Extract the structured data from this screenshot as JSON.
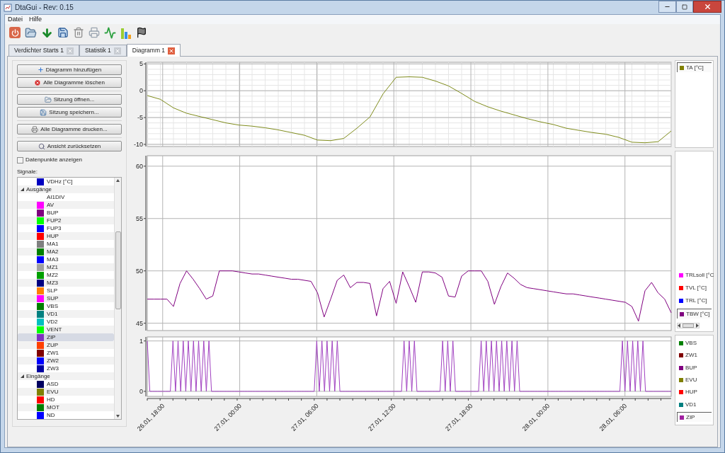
{
  "window": {
    "title": "DtaGui - Rev: 0.15"
  },
  "menu": [
    "Datei",
    "Hilfe"
  ],
  "tabs": [
    {
      "label": "Verdichter Starts 1",
      "selected": false
    },
    {
      "label": "Statistik 1",
      "selected": false
    },
    {
      "label": "Diagramm 1",
      "selected": true
    }
  ],
  "side_panel": {
    "button_groups": [
      [
        "Diagramm hinzufügen",
        "Alle Diagramme löschen"
      ],
      [
        "Sitzung öffnen...",
        "Sitzung speichern..."
      ],
      [
        "Alle Diagramme drucken..."
      ],
      [
        "Ansicht zurücksetzen"
      ]
    ],
    "show_datapoints": {
      "label": "Datenpunkte anzeigen",
      "checked": false
    },
    "signals_label": "Signale:",
    "signal_tree": [
      {
        "label": "VDHz [°C]",
        "color": "#0000c0",
        "selected": false
      },
      {
        "label": "Ausgänge",
        "expanded": true,
        "children": [
          {
            "label": "AI1DIV",
            "selected": false
          },
          {
            "label": "AV",
            "color": "#ff00ff",
            "selected": false
          },
          {
            "label": "BUP",
            "color": "#800080",
            "selected": false
          },
          {
            "label": "FUP2",
            "color": "#00ff00",
            "selected": false
          },
          {
            "label": "FUP3",
            "color": "#0000ff",
            "selected": false
          },
          {
            "label": "HUP",
            "color": "#ff0000",
            "selected": false
          },
          {
            "label": "MA1",
            "color": "#808080",
            "selected": false
          },
          {
            "label": "MA2",
            "color": "#008000",
            "selected": false
          },
          {
            "label": "MA3",
            "color": "#0000ff",
            "selected": false
          },
          {
            "label": "MZ1",
            "color": "#a0a0a0",
            "selected": false
          },
          {
            "label": "MZ2",
            "color": "#00a000",
            "selected": false
          },
          {
            "label": "MZ3",
            "color": "#000080",
            "selected": false
          },
          {
            "label": "SLP",
            "color": "#ff8000",
            "selected": false
          },
          {
            "label": "SUP",
            "color": "#ff00ff",
            "selected": false
          },
          {
            "label": "VBS",
            "color": "#008000",
            "selected": false
          },
          {
            "label": "VD1",
            "color": "#008080",
            "selected": false
          },
          {
            "label": "VD2",
            "color": "#00c0c0",
            "selected": false
          },
          {
            "label": "VENT",
            "color": "#00ff00",
            "selected": false
          },
          {
            "label": "ZIP",
            "color": "#8030c0",
            "selected": true
          },
          {
            "label": "ZUP",
            "color": "#ff4000",
            "selected": false
          },
          {
            "label": "ZW1",
            "color": "#800000",
            "selected": false
          },
          {
            "label": "ZW2",
            "color": "#0000ff",
            "selected": false
          },
          {
            "label": "ZW3",
            "color": "#0000a0",
            "selected": false
          }
        ]
      },
      {
        "label": "Eingänge",
        "expanded": true,
        "children": [
          {
            "label": "ASD",
            "color": "#000060",
            "selected": false
          },
          {
            "label": "EVU",
            "color": "#808000",
            "selected": false
          },
          {
            "label": "HD",
            "color": "#ff0000",
            "selected": false
          },
          {
            "label": "MOT",
            "color": "#008000",
            "selected": false
          },
          {
            "label": "ND",
            "color": "#0000ff",
            "selected": false
          }
        ]
      }
    ]
  },
  "charts": [
    {
      "legend": [
        {
          "label": "TA [°C]",
          "color": "#808000",
          "selected": true
        }
      ],
      "chart_data": {
        "type": "line",
        "grid": true,
        "categories": [
          null,
          null,
          null,
          null,
          null,
          null,
          null,
          null,
          null,
          null,
          null,
          null,
          null,
          null,
          null,
          null,
          null,
          null,
          null,
          null,
          null,
          null,
          null,
          null,
          null,
          null,
          null,
          null,
          null,
          null,
          null,
          null,
          null,
          null,
          null,
          null,
          null,
          null,
          null,
          null,
          null
        ],
        "series": [
          {
            "color": "#7f8c1c",
            "values": [
              -0.9,
              -1.6,
              -3.2,
              -4.2,
              -4.8,
              -5.4,
              -6.0,
              -6.4,
              -6.6,
              -6.9,
              -7.3,
              -7.8,
              -8.3,
              -9.2,
              -9.3,
              -8.9,
              -7.0,
              -4.9,
              -0.6,
              2.5,
              2.6,
              2.5,
              1.8,
              0.9,
              -0.5,
              -2.0,
              -3.0,
              -3.8,
              -4.5,
              -5.2,
              -5.8,
              -6.3,
              -7.0,
              -7.4,
              -7.8,
              -8.1,
              -8.7,
              -9.6,
              -9.7,
              -9.5,
              -7.5
            ]
          }
        ],
        "ylim": [
          -10.4,
          5.3
        ],
        "yticks": [
          -10,
          -5,
          0,
          5
        ]
      }
    },
    {
      "legend": [
        {
          "label": "TRLsoll [°C",
          "color": "#ff00ff",
          "selected": false
        },
        {
          "label": "TVL [°C]",
          "color": "#ff0000",
          "selected": false
        },
        {
          "label": "TRL [°C]",
          "color": "#0000ff",
          "selected": false
        },
        {
          "label": "TBW [°C]",
          "color": "#800080",
          "selected": true
        }
      ],
      "chart_data": {
        "type": "line",
        "grid": true,
        "categories": [
          null,
          null,
          null,
          null,
          null,
          null,
          null,
          null,
          null,
          null,
          null,
          null,
          null,
          null,
          null,
          null,
          null,
          null,
          null,
          null,
          null,
          null,
          null,
          null,
          null,
          null,
          null,
          null,
          null,
          null,
          null,
          null,
          null,
          null,
          null,
          null,
          null,
          null,
          null,
          null,
          null,
          null,
          null,
          null,
          null,
          null,
          null,
          null,
          null,
          null,
          null,
          null,
          null,
          null,
          null,
          null,
          null,
          null,
          null,
          null,
          null,
          null,
          null,
          null,
          null,
          null,
          null,
          null,
          null,
          null,
          null,
          null,
          null,
          null,
          null,
          null,
          null,
          null,
          null,
          null,
          null
        ],
        "series": [
          {
            "color": "#800080",
            "values": [
              47.3,
              47.3,
              47.3,
              47.3,
              46.6,
              48.8,
              50,
              49.2,
              48.3,
              47.3,
              47.6,
              50,
              50,
              50,
              49.9,
              49.8,
              49.7,
              49.7,
              49.6,
              49.5,
              49.4,
              49.3,
              49.2,
              49.2,
              49.1,
              49.0,
              47.9,
              45.6,
              47.3,
              49.1,
              49.6,
              48.4,
              48.9,
              48.9,
              48.8,
              45.7,
              48.3,
              49,
              46.9,
              49.9,
              48.5,
              47.0,
              49.9,
              49.9,
              49.8,
              49.4,
              47.6,
              47.5,
              49.5,
              50,
              50,
              50,
              49,
              46.8,
              48.5,
              49.8,
              49.3,
              48.7,
              48.4,
              48.3,
              48.2,
              48.1,
              48.0,
              47.9,
              47.8,
              47.8,
              47.7,
              47.6,
              47.5,
              47.4,
              47.3,
              47.2,
              47.1,
              47.0,
              46.6,
              45.2,
              48.1,
              48.9,
              47.9,
              47.3,
              46
            ]
          }
        ],
        "ylim": [
          44.3,
          61
        ],
        "yticks": [
          45,
          50,
          55,
          60
        ]
      }
    },
    {
      "legend": [
        {
          "label": "VBS",
          "color": "#008000",
          "selected": false
        },
        {
          "label": "ZW1",
          "color": "#800000",
          "selected": false
        },
        {
          "label": "BUP",
          "color": "#800080",
          "selected": false
        },
        {
          "label": "EVU",
          "color": "#808000",
          "selected": false
        },
        {
          "label": "HUP",
          "color": "#ff0000",
          "selected": false
        },
        {
          "label": "VD1",
          "color": "#008080",
          "selected": false
        },
        {
          "label": "ZIP",
          "color": "#a020a0",
          "selected": true
        }
      ],
      "chart_data": {
        "type": "line",
        "grid": true,
        "categories": [
          null,
          null,
          null,
          null,
          null,
          null,
          "26.01, 18:00",
          null,
          null,
          null,
          null,
          null,
          null,
          null,
          null,
          null,
          null,
          null,
          null,
          null,
          null,
          null,
          null,
          null,
          null,
          null,
          null,
          null,
          null,
          null,
          null,
          null,
          null,
          null,
          null,
          null,
          "27.01, 00:00",
          null,
          null,
          null,
          null,
          null,
          null,
          null,
          null,
          null,
          null,
          null,
          null,
          null,
          null,
          null,
          null,
          null,
          null,
          null,
          null,
          null,
          null,
          null,
          null,
          null,
          null,
          null,
          null,
          null,
          "27.01, 06:00",
          null,
          null,
          null,
          null,
          null,
          null,
          null,
          null,
          null,
          null,
          null,
          null,
          null,
          null,
          null,
          null,
          null,
          null,
          null,
          null,
          null,
          null,
          null,
          null,
          null,
          null,
          null,
          null,
          null,
          "27.01, 12:00",
          null,
          null,
          null,
          null,
          null,
          null,
          null,
          null,
          null,
          null,
          null,
          null,
          null,
          null,
          null,
          null,
          null,
          null,
          null,
          null,
          null,
          null,
          null,
          null,
          null,
          null,
          null,
          null,
          null,
          "27.01, 18:00",
          null,
          null,
          null,
          null,
          null,
          null,
          null,
          null,
          null,
          null,
          null,
          null,
          null,
          null,
          null,
          null,
          null,
          null,
          null,
          null,
          null,
          null,
          null,
          null,
          null,
          null,
          null,
          null,
          null,
          "28.01, 00:00",
          null,
          null,
          null,
          null,
          null,
          null,
          null,
          null,
          null,
          null,
          null,
          null,
          null,
          null,
          null,
          null,
          null,
          null,
          null,
          null,
          null,
          null,
          null,
          null,
          null,
          null,
          null,
          null,
          null,
          "28.01, 06:00",
          null,
          null,
          null,
          null,
          null,
          null,
          null,
          null,
          null,
          null,
          null,
          null,
          null,
          null,
          null,
          null,
          null,
          null
        ],
        "series": [
          {
            "color": "#a040c0",
            "values": [
              1,
              0,
              0,
              0,
              0,
              0,
              0,
              0,
              0,
              0,
              1,
              0,
              1,
              0,
              1,
              0,
              1,
              0,
              1,
              0,
              1,
              0,
              1,
              0,
              1,
              0,
              0,
              0,
              0,
              0,
              0,
              0,
              0,
              0,
              0,
              0,
              0,
              0,
              0,
              0,
              0,
              0,
              0,
              0,
              0,
              0,
              0,
              0,
              0,
              0,
              0,
              0,
              0,
              0,
              0,
              0,
              0,
              0,
              0,
              0,
              0,
              0,
              0,
              0,
              0,
              0,
              1,
              0,
              1,
              0,
              1,
              0,
              1,
              0,
              1,
              0,
              0,
              0,
              0,
              0,
              0,
              0,
              0,
              0,
              0,
              0,
              0,
              0,
              0,
              0,
              0,
              0,
              0,
              0,
              0,
              0,
              0,
              0,
              0,
              0,
              1,
              0,
              1,
              0,
              1,
              0,
              0,
              0,
              0,
              0,
              0,
              0,
              0,
              0,
              0,
              1,
              0,
              1,
              0,
              1,
              0,
              0,
              0,
              0,
              0,
              0,
              0,
              0,
              0,
              0,
              1,
              0,
              1,
              0,
              1,
              0,
              1,
              0,
              1,
              0,
              1,
              0,
              1,
              0,
              1,
              0,
              0,
              0,
              0,
              0,
              0,
              0,
              0,
              0,
              0,
              0,
              0,
              0,
              0,
              0,
              0,
              0,
              0,
              0,
              0,
              0,
              0,
              0,
              0,
              0,
              0,
              0,
              0,
              0,
              0,
              0,
              0,
              0,
              0,
              0,
              0,
              0,
              0,
              0,
              0,
              1,
              0,
              1,
              0,
              1,
              0,
              1,
              0,
              1,
              0,
              0,
              0,
              0,
              0,
              0,
              0,
              0,
              0,
              0,
              0
            ]
          }
        ],
        "ylim": [
          -0.1,
          1.08
        ],
        "yticks": [
          0,
          1
        ]
      }
    }
  ]
}
